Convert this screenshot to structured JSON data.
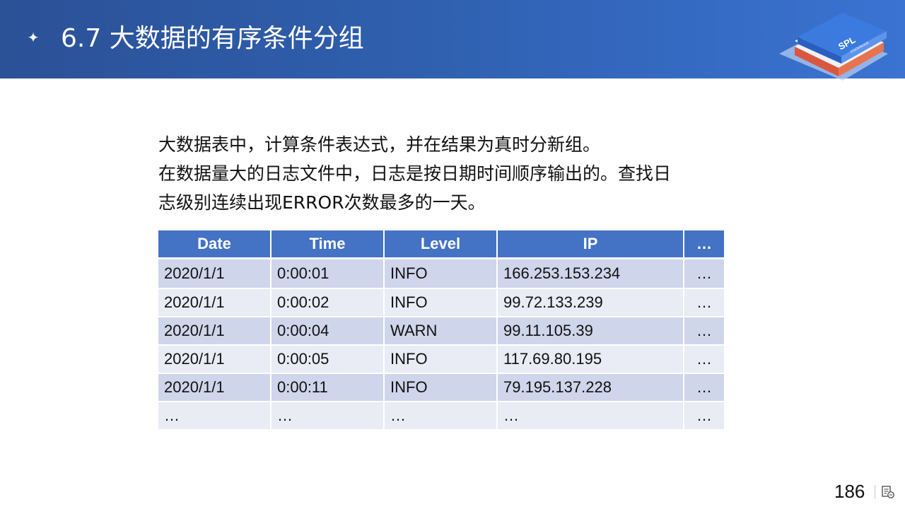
{
  "header": {
    "bullet_icon": "four-point-star-icon",
    "title": "6.7  大数据的有序条件分组",
    "logo": {
      "text": "SPL",
      "subtext": "COOKBOOK",
      "icon": "book-stack-logo"
    }
  },
  "description": {
    "lines": [
      "大数据表中，计算条件表达式，并在结果为真时分新组。",
      "在数据量大的日志文件中，日志是按日期时间顺序输出的。查找日",
      "志级别连续出现ERROR次数最多的一天。"
    ]
  },
  "table": {
    "headers": [
      "Date",
      "Time",
      "Level",
      "IP",
      "…"
    ],
    "rows": [
      [
        "2020/1/1",
        "0:00:01",
        "INFO",
        "166.253.153.234",
        "…"
      ],
      [
        "2020/1/1",
        "0:00:02",
        "INFO",
        "99.72.133.239",
        "…"
      ],
      [
        "2020/1/1",
        "0:00:04",
        "WARN",
        "99.11.105.39",
        "…"
      ],
      [
        "2020/1/1",
        "0:00:05",
        "INFO",
        "117.69.80.195",
        "…"
      ],
      [
        "2020/1/1",
        "0:00:11",
        "INFO",
        "79.195.137.228",
        "…"
      ],
      [
        "…",
        "…",
        "…",
        "…",
        "…"
      ]
    ]
  },
  "footer": {
    "page_number": "186",
    "notes_icon": "notes-icon"
  },
  "colors": {
    "header_blue": "#2f5fae",
    "table_header": "#4472c4",
    "row_odd": "#cfd5ea",
    "row_even": "#e9ebf5"
  }
}
